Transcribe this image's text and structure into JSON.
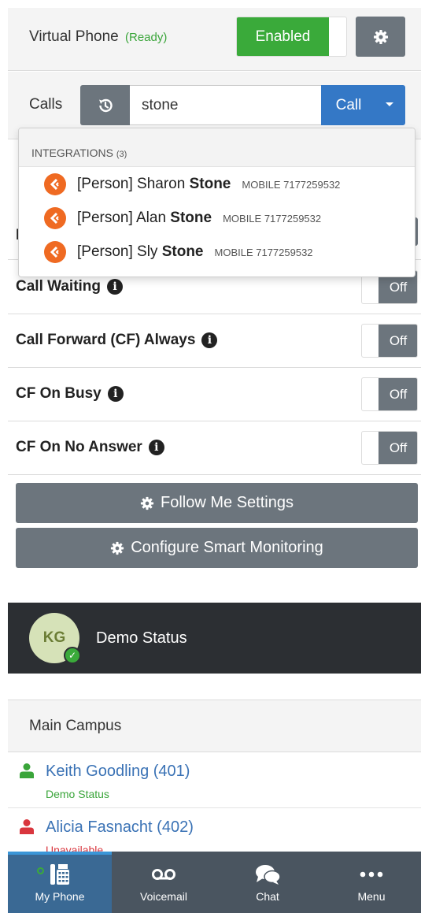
{
  "virtual_phone": {
    "label": "Virtual Phone",
    "status": "(Ready)",
    "toggle_label": "Enabled",
    "toggle_enabled": true
  },
  "calls": {
    "label": "Calls",
    "search_value": "stone",
    "call_button_label": "Call"
  },
  "integrations_dropdown": {
    "header": "INTEGRATIONS",
    "count": "(3)",
    "items": [
      {
        "prefix": "[Person] Sharon ",
        "match": "Stone",
        "phone_label": "MOBILE 7177259532"
      },
      {
        "prefix": "[Person] Alan ",
        "match": "Stone",
        "phone_label": "MOBILE 7177259532"
      },
      {
        "prefix": "[Person] Sly ",
        "match": "Stone",
        "phone_label": "MOBILE 7177259532"
      }
    ]
  },
  "partial_row": {
    "letter": "I"
  },
  "settings": [
    {
      "label": "Call Waiting",
      "toggle": "Off"
    },
    {
      "label": "Call Forward (CF) Always",
      "toggle": "Off"
    },
    {
      "label": "CF On Busy",
      "toggle": "Off"
    },
    {
      "label": "CF On No Answer",
      "toggle": "Off"
    }
  ],
  "buttons": {
    "follow_me": "Follow Me Settings",
    "smart_monitoring": "Configure Smart Monitoring"
  },
  "user_status": {
    "initials": "KG",
    "status_text": "Demo Status"
  },
  "directory": {
    "group_name": "Main Campus",
    "contacts": [
      {
        "name": "Keith Goodling (401)",
        "status": "Demo Status",
        "color": "#3aa53a"
      },
      {
        "name": "Alicia Fasnacht (402)",
        "status": "Unavailable",
        "color": "#d9363e"
      }
    ]
  },
  "bottom_nav": [
    {
      "label": "My Phone",
      "icon": "desk-phone-icon",
      "active": true
    },
    {
      "label": "Voicemail",
      "icon": "voicemail-icon",
      "active": false
    },
    {
      "label": "Chat",
      "icon": "chat-bubbles-icon",
      "active": false
    },
    {
      "label": "Menu",
      "icon": "ellipsis-icon",
      "active": false
    }
  ],
  "colors": {
    "enabled_green": "#3aaa3a",
    "call_blue": "#3478c6",
    "button_gray": "#6c757d",
    "integration_orange": "#ef6a22",
    "nav_bg": "#4a5560",
    "nav_active": "#3a6994"
  }
}
